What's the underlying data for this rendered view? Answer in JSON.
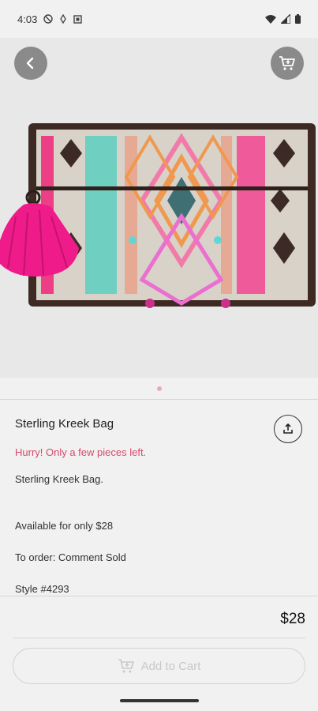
{
  "status_bar": {
    "time": "4:03"
  },
  "header": {
    "back_icon": "arrow-left-icon",
    "cart_icon": "cart-icon"
  },
  "product": {
    "title": "Sterling Kreek Bag",
    "urgency": "Hurry! Only a few pieces left.",
    "description": [
      "Sterling Kreek Bag.",
      "Available for only $28",
      "To order: Comment Sold",
      "Style #4293"
    ],
    "price": "$28",
    "image_count": 1,
    "active_image": 1
  },
  "actions": {
    "add_to_cart_label": "Add to Cart",
    "share_icon": "share-icon"
  },
  "colors": {
    "accent": "#d24b6c",
    "dot": "#e7a9ba",
    "disabled_text": "#c9c8c8"
  }
}
